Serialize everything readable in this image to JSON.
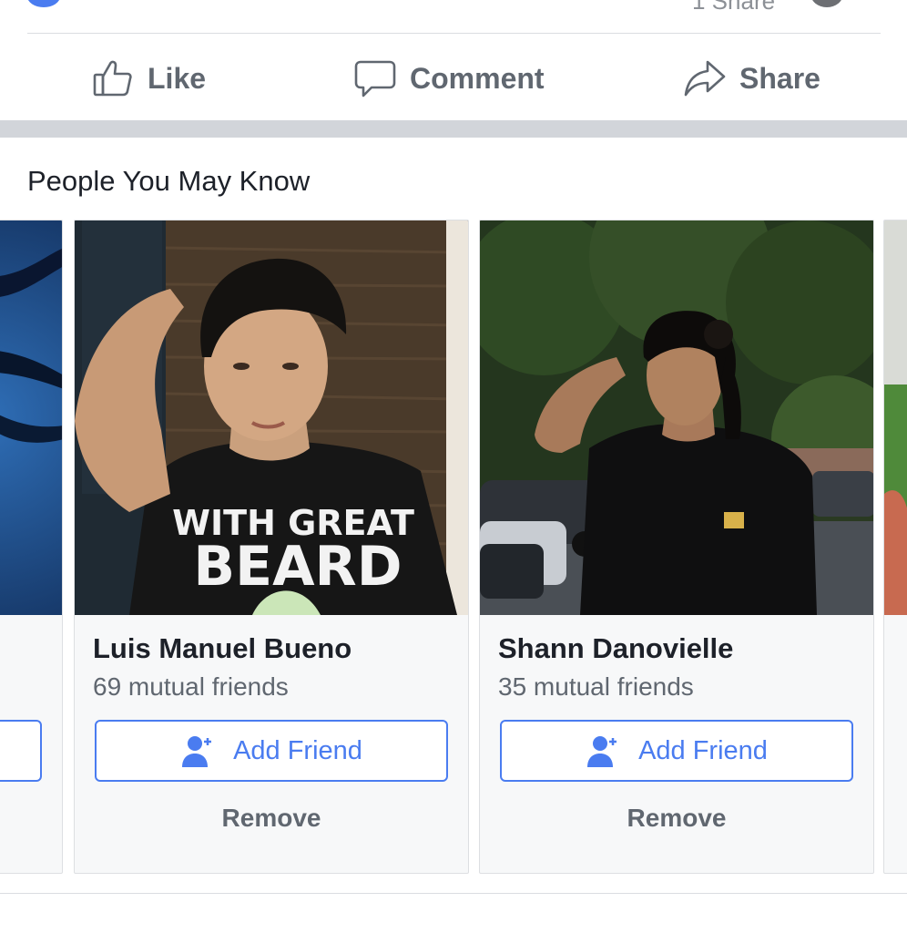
{
  "previous_post": {
    "share_count_text": "1 Share"
  },
  "actions": {
    "like_label": "Like",
    "comment_label": "Comment",
    "share_label": "Share"
  },
  "pymk": {
    "title": "People You May Know",
    "cards": [
      {
        "name": "Luis Manuel Bueno",
        "mutual": "69 mutual friends",
        "add_label": "Add Friend",
        "remove_label": "Remove",
        "shirt_text_line1": "WITH GREAT",
        "shirt_text_line2": "BEARD"
      },
      {
        "name": "Shann Danovielle",
        "mutual": "35 mutual friends",
        "add_label": "Add Friend",
        "remove_label": "Remove"
      }
    ]
  },
  "colors": {
    "accent": "#4a7cf0",
    "text_secondary": "#606770",
    "divider": "#dadde1",
    "band": "#d2d5da"
  }
}
